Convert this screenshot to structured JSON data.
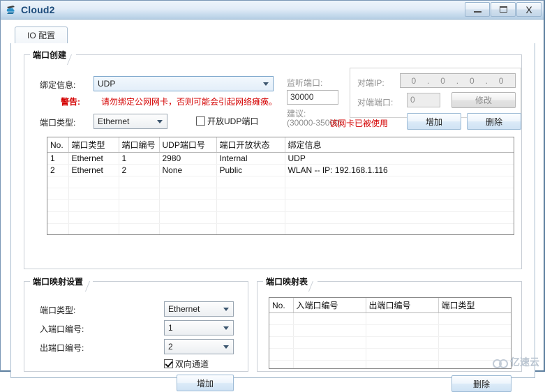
{
  "window": {
    "title": "Cloud2",
    "icon": "cloud-device-icon",
    "buttons": {
      "minimize": "minimize-icon",
      "maximize": "maximize-icon",
      "close": "X"
    }
  },
  "tab": {
    "label": "IO 配置"
  },
  "port_create": {
    "title": "端口创建",
    "binding_label": "绑定信息:",
    "binding_value": "UDP",
    "warning_label": "警告:",
    "warning_text": "请勿绑定公网网卡，否则可能会引起网络瘫痪。",
    "port_type_label": "端口类型:",
    "port_type_value": "Ethernet",
    "open_udp_checkbox": "开放UDP端口",
    "open_udp_checked": false,
    "listen_port_label": "监听端口:",
    "listen_port_value": "30000",
    "suggest_label": "建议:",
    "suggest_range": "(30000-35000)",
    "peer_ip_label": "对端IP:",
    "peer_ip_octets": [
      "0",
      "0",
      "0",
      "0"
    ],
    "peer_port_label": "对端端口:",
    "peer_port_value": "0",
    "modify_button": "修改",
    "nic_in_use_text": "该网卡已被使用",
    "add_button": "增加",
    "delete_button": "删除"
  },
  "port_table": {
    "columns": [
      "No.",
      "端口类型",
      "端口编号",
      "UDP端口号",
      "端口开放状态",
      "绑定信息"
    ],
    "rows": [
      [
        "1",
        "Ethernet",
        "1",
        "2980",
        "Internal",
        "UDP"
      ],
      [
        "2",
        "Ethernet",
        "2",
        "None",
        "Public",
        "WLAN -- IP: 192.168.1.116"
      ]
    ],
    "empty_rows": 5
  },
  "mapping_settings": {
    "title": "端口映射设置",
    "port_type_label": "端口类型:",
    "port_type_value": "Ethernet",
    "in_port_label": "入端口编号:",
    "in_port_value": "1",
    "out_port_label": "出端口编号:",
    "out_port_value": "2",
    "bidirectional_label": "双向通道",
    "bidirectional_checked": true,
    "add_button": "增加"
  },
  "mapping_table": {
    "title": "端口映射表",
    "columns": [
      "No.",
      "入端口编号",
      "出端口编号",
      "端口类型"
    ],
    "rows": [],
    "empty_rows": 5,
    "delete_button": "删除"
  },
  "watermark": {
    "text": "亿速云"
  },
  "colors": {
    "accent": "#1b4a7a",
    "warning": "#d40000",
    "disabled": "#8e8e8e",
    "titlebar_top": "#eef4fb",
    "titlebar_bottom": "#b6cee4"
  }
}
